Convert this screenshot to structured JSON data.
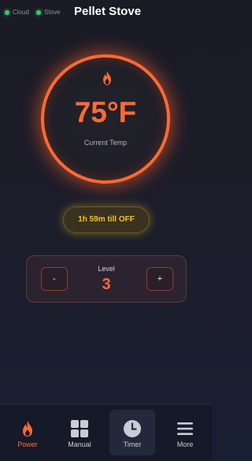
{
  "header": {
    "title": "Pellet Stove",
    "status": [
      {
        "label": "Cloud",
        "state": "connected",
        "color": "#3ec46d"
      },
      {
        "label": "Stove",
        "state": "connected",
        "color": "#3ec46d"
      }
    ]
  },
  "temperature": {
    "value": "75°F",
    "label": "Current Temp",
    "icon": "flame-icon",
    "ring_color": "#ff6a30"
  },
  "timer": {
    "text": "1h 59m till OFF",
    "color": "#f2c230"
  },
  "level": {
    "label": "Level",
    "value": "3",
    "decrement_label": "-",
    "increment_label": "+"
  },
  "nav": {
    "items": [
      {
        "label": "Power",
        "icon": "flame-icon",
        "active": true
      },
      {
        "label": "Manual",
        "icon": "grid-icon",
        "active": false
      },
      {
        "label": "Timer",
        "icon": "clock-icon",
        "selected": true
      },
      {
        "label": "More",
        "icon": "menu-icon",
        "active": false
      }
    ]
  },
  "colors": {
    "accent": "#ff6b35",
    "status_ok": "#3ec46d",
    "timer": "#f2c230"
  }
}
